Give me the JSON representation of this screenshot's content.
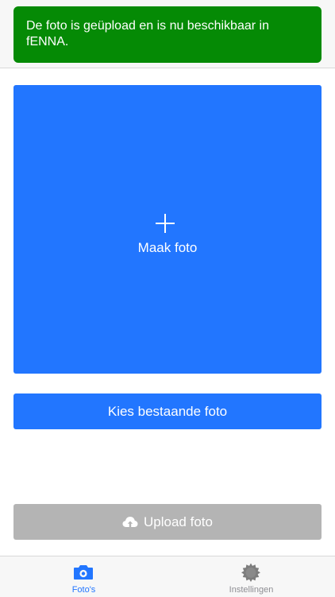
{
  "toast": {
    "message": "De foto is geüpload en is nu beschikbaar in fENNA."
  },
  "camera_tile": {
    "icon": "plus-icon",
    "label": "Maak foto"
  },
  "choose_button": {
    "label": "Kies bestaande foto"
  },
  "upload_button": {
    "icon": "cloud-upload-icon",
    "label": "Upload foto"
  },
  "tabbar": {
    "tabs": [
      {
        "label": "Foto's",
        "icon": "camera-icon",
        "active": true
      },
      {
        "label": "Instellingen",
        "icon": "gear-icon",
        "active": false
      }
    ]
  },
  "colors": {
    "toast_bg": "#058a05",
    "primary": "#2276ff",
    "disabled": "#b4b4b4",
    "tab_active": "#2276ff",
    "tab_inactive": "#8e8e93"
  }
}
